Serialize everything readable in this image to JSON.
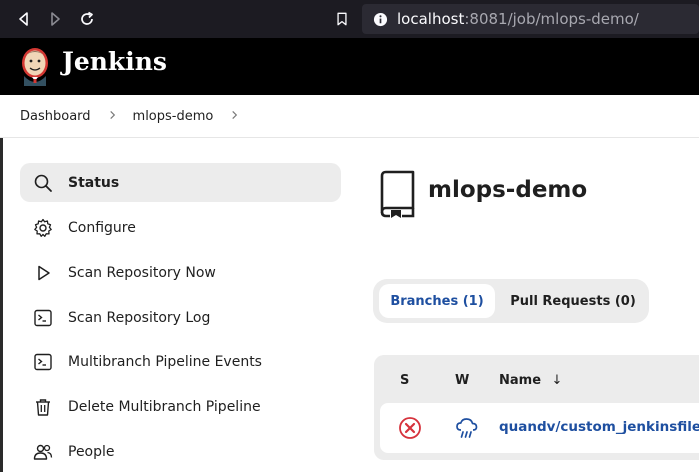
{
  "browser": {
    "url_host": "localhost",
    "url_rest": ":8081/job/mlops-demo/"
  },
  "header": {
    "title": "Jenkins"
  },
  "breadcrumb": {
    "items": [
      "Dashboard",
      "mlops-demo"
    ],
    "separator": ">"
  },
  "sidebar": {
    "items": [
      {
        "label": "Status",
        "icon": "search-icon",
        "active": true
      },
      {
        "label": "Configure",
        "icon": "gear-icon"
      },
      {
        "label": "Scan Repository Now",
        "icon": "play-icon"
      },
      {
        "label": "Scan Repository Log",
        "icon": "terminal-icon"
      },
      {
        "label": "Multibranch Pipeline Events",
        "icon": "terminal-icon"
      },
      {
        "label": "Delete Multibranch Pipeline",
        "icon": "trash-icon"
      },
      {
        "label": "People",
        "icon": "people-icon"
      }
    ]
  },
  "main": {
    "title": "mlops-demo",
    "tabs": [
      {
        "label": "Branches (1)",
        "active": true
      },
      {
        "label": "Pull Requests (0)"
      }
    ],
    "table": {
      "headers": {
        "s": "S",
        "w": "W",
        "name": "Name",
        "sort": "↓"
      },
      "rows": [
        {
          "status": "failed",
          "weather": "stormy",
          "name": "quandv/custom_jenkinsfile"
        }
      ]
    }
  },
  "colors": {
    "link": "#1e4fa0",
    "failed": "#d6323c",
    "weather": "#1e4fa0"
  }
}
